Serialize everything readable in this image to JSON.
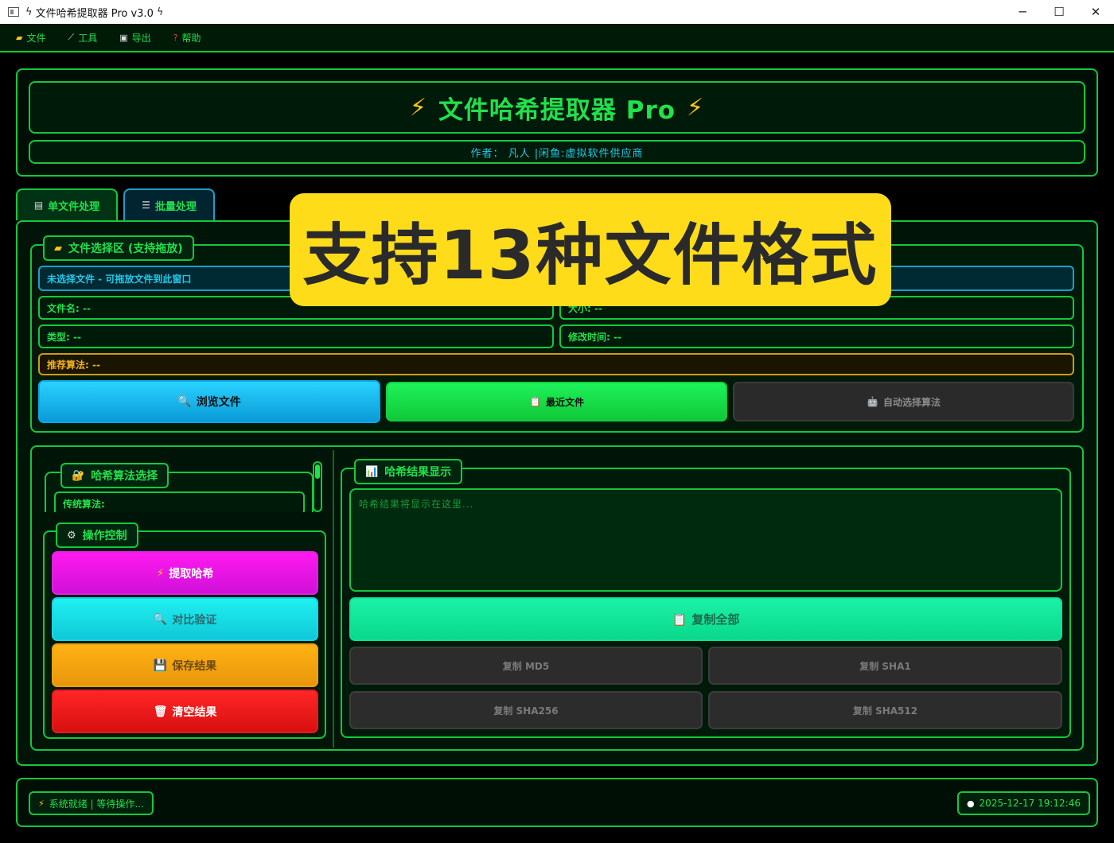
{
  "window": {
    "title": "文件哈希提取器 Pro v3.0",
    "controls": {
      "minimize": "─",
      "maximize": "☐",
      "close": "✕"
    }
  },
  "menubar": {
    "items": [
      {
        "label": "文件",
        "icon": "folder-icon",
        "glyph": "▰"
      },
      {
        "label": "工具",
        "icon": "wand-icon",
        "glyph": "⟋"
      },
      {
        "label": "导出",
        "icon": "save-icon",
        "glyph": "▣"
      },
      {
        "label": "帮助",
        "icon": "question-icon",
        "glyph": "?"
      }
    ]
  },
  "header": {
    "title": "文件哈希提取器 Pro",
    "title_glyph": "⚡",
    "author": "作者： 凡人 |闲鱼:虚拟软件供应商"
  },
  "tabs": [
    {
      "label": "单文件处理",
      "glyph": "▤"
    },
    {
      "label": "批量处理",
      "glyph": "☰"
    }
  ],
  "file_section": {
    "legend": "文件选择区 (支持拖放)",
    "status_text": "未选择文件 - 可拖放文件到此窗口",
    "filename": "文件名: --",
    "size": "大小: --",
    "type": "类型: --",
    "modified": "修改时间: --",
    "recommended": "推荐算法: --",
    "browse_button": "浏览文件",
    "recent_button": "最近文件",
    "auto_button": "自动选择算法"
  },
  "algo_section": {
    "legend": "哈希算法选择",
    "traditional_label": "传统算法:"
  },
  "ops_section": {
    "legend": "操作控制",
    "extract_button": "提取哈希",
    "compare_button": "对比验证",
    "save_button": "保存结果",
    "clear_button": "清空结果"
  },
  "result_section": {
    "legend": "哈希结果显示",
    "placeholder": "哈希结果将显示在这里...",
    "copy_all": "复制全部",
    "copy_md5": "复制 MD5",
    "copy_sha1": "复制 SHA1",
    "copy_sha256": "复制 SHA256",
    "copy_sha512": "复制 SHA512"
  },
  "statusbar": {
    "status": "系统就绪 | 等待操作...",
    "clock": "2025-12-17 19:12:46"
  },
  "overlay": {
    "text": "支持13种文件格式"
  },
  "colors": {
    "accent_green": "#22e04a",
    "border_green": "#12c93c",
    "cyan_text": "#22c8e8",
    "amber_text": "#f0b020",
    "bolt_yellow": "#ffc61a",
    "overlay_bg": "#ffdc1a"
  }
}
